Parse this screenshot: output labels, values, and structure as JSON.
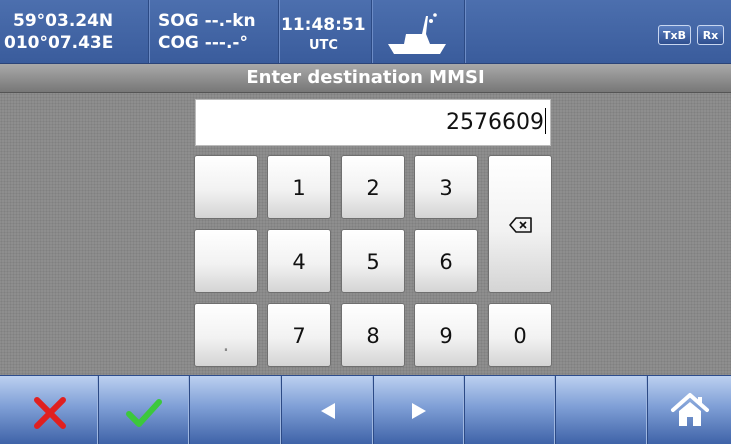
{
  "status": {
    "lat": "59°03.24N",
    "lon": "010°07.43E",
    "sog": "SOG --.-kn",
    "cog": "COG ---.-°",
    "time": "11:48:51",
    "timezone": "UTC",
    "txb_label": "TxB",
    "rx_label": "Rx"
  },
  "title": "Enter destination MMSI",
  "input": {
    "value": "2576609"
  },
  "keypad": {
    "rows": [
      [
        "",
        "1",
        "2",
        "3"
      ],
      [
        "",
        "4",
        "5",
        "6"
      ],
      [
        ".",
        "7",
        "8",
        "9",
        "0"
      ]
    ],
    "backspace_icon": "backspace-icon"
  },
  "toolbar": {
    "cancel_icon": "x-icon",
    "confirm_icon": "checkmark-icon",
    "left_icon": "arrow-left-icon",
    "right_icon": "arrow-right-icon",
    "home_icon": "home-icon"
  },
  "colors": {
    "status_bar": "#3f62a3",
    "toolbar": "#7f9fd6",
    "cancel": "#e02020",
    "confirm": "#3cc83c"
  }
}
